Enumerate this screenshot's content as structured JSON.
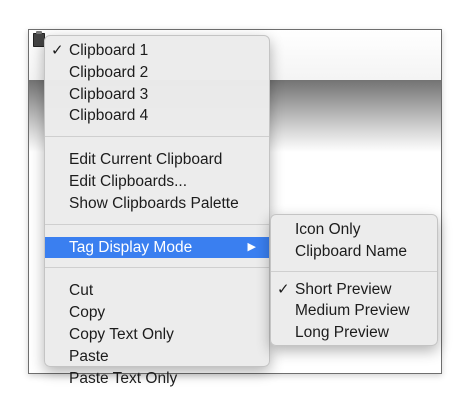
{
  "main_menu": {
    "groups": [
      [
        {
          "label": "Clipboard 1",
          "checked": true
        },
        {
          "label": "Clipboard 2",
          "checked": false
        },
        {
          "label": "Clipboard 3",
          "checked": false
        },
        {
          "label": "Clipboard 4",
          "checked": false
        }
      ],
      [
        {
          "label": "Edit Current Clipboard"
        },
        {
          "label": "Edit Clipboards..."
        },
        {
          "label": "Show Clipboards Palette"
        }
      ],
      [
        {
          "label": "Tag Display Mode",
          "selected": true,
          "submenu_arrow": "▶"
        }
      ],
      [
        {
          "label": "Cut"
        },
        {
          "label": "Copy"
        },
        {
          "label": "Copy Text Only"
        },
        {
          "label": "Paste"
        },
        {
          "label": "Paste Text Only"
        }
      ]
    ]
  },
  "submenu": {
    "groups": [
      [
        {
          "label": "Icon Only",
          "checked": false
        },
        {
          "label": "Clipboard Name",
          "checked": false
        }
      ],
      [
        {
          "label": "Short Preview",
          "checked": true
        },
        {
          "label": "Medium Preview",
          "checked": false
        },
        {
          "label": "Long Preview",
          "checked": false
        }
      ]
    ]
  },
  "check_glyph": "✓",
  "colors": {
    "highlight": "#3a7ff0",
    "menu_background": "#ececec",
    "text": "#1c1c1c"
  }
}
